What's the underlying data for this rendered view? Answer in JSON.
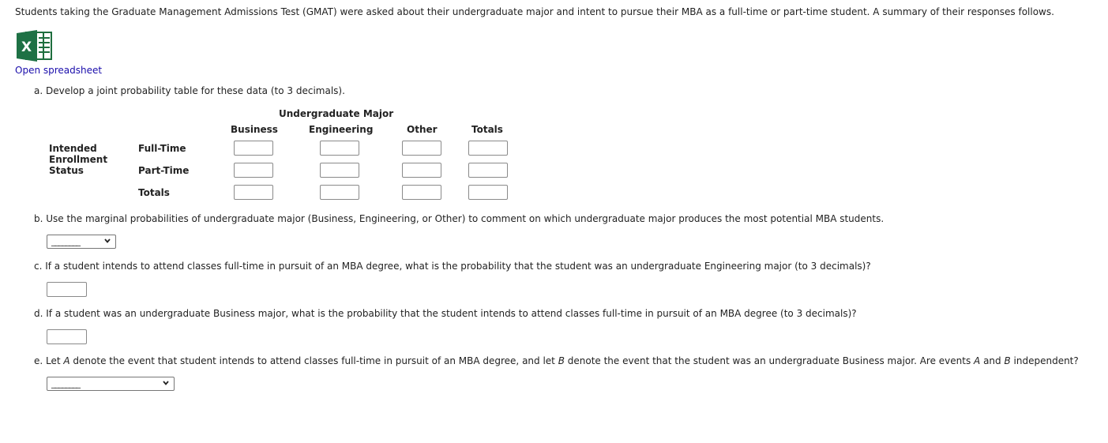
{
  "intro_text": "Students taking the Graduate Management Admissions Test (GMAT) were asked about their undergraduate major and intent to pursue their MBA as a full-time or part-time student. A summary of their responses follows.",
  "spreadsheet": {
    "icon": "excel-icon",
    "link_label": "Open spreadsheet",
    "icon_colors": {
      "dark": "#1e6e3e",
      "mid": "#21a366",
      "light": "#ffffff"
    }
  },
  "part_a": {
    "question": "a. Develop a joint probability table for these data (to 3 decimals).",
    "table": {
      "group_header": "Undergraduate Major",
      "columns": [
        "Business",
        "Engineering",
        "Other",
        "Totals"
      ],
      "row_group_label": [
        "Intended",
        "Enrollment",
        "Status"
      ],
      "rows": [
        {
          "label": "Full-Time",
          "values": [
            "",
            "",
            "",
            ""
          ]
        },
        {
          "label": "Part-Time",
          "values": [
            "",
            "",
            "",
            ""
          ]
        },
        {
          "label": "Totals",
          "values": [
            "",
            "",
            "",
            ""
          ]
        }
      ]
    }
  },
  "part_b": {
    "question": "b. Use the marginal probabilities of undergraduate major (Business, Engineering, or Other) to comment on which undergraduate major produces the most potential MBA students.",
    "select_value": "________"
  },
  "part_c": {
    "question": "c. If a student intends to attend classes full-time in pursuit of an MBA degree, what is the probability that the student was an undergraduate Engineering major (to 3 decimals)?",
    "answer": ""
  },
  "part_d": {
    "question": "d. If a student was an undergraduate Business major, what is the probability that the student intends to attend classes full-time in pursuit of an MBA degree (to 3 decimals)?",
    "answer": ""
  },
  "part_e": {
    "question_parts": [
      "e. Let ",
      "A",
      " denote the event that student intends to attend classes full-time in pursuit of an MBA degree, and let ",
      "B",
      " denote the event that the student was an undergraduate Business major. Are events ",
      "A",
      " and ",
      "B",
      " independent?"
    ],
    "select_value": "________"
  }
}
